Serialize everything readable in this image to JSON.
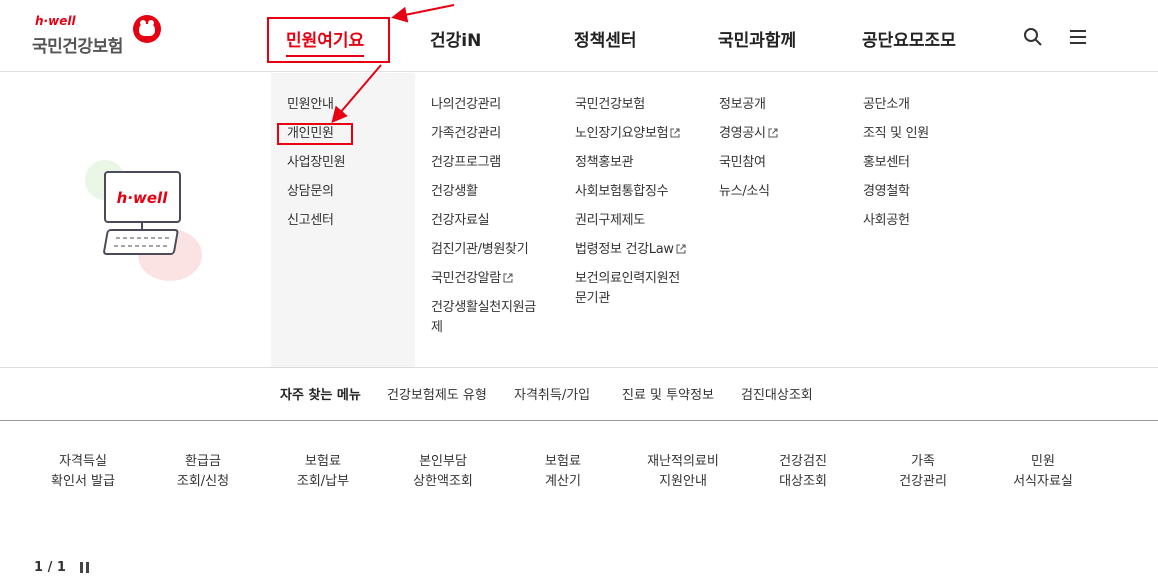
{
  "logo": {
    "brand": "h·well",
    "org_name": "국민건강보험"
  },
  "gnb": {
    "items": [
      "민원여기요",
      "건강iN",
      "정책센터",
      "국민과함께",
      "공단요모조모"
    ],
    "active_index": 0,
    "icons": [
      "search-icon",
      "menu-icon"
    ]
  },
  "mega_menu": {
    "col1": [
      "민원안내",
      "개인민원",
      "사업장민원",
      "상담문의",
      "신고센터"
    ],
    "col2": [
      "나의건강관리",
      "가족건강관리",
      "건강프로그램",
      "건강생활",
      "건강자료실",
      "검진기관/병원찾기",
      "국민건강알람",
      "건강생활실천지원금제"
    ],
    "col3": [
      "국민건강보험",
      "노인장기요양보험",
      "정책홍보관",
      "사회보험통합징수",
      "권리구제제도",
      "법령정보 건강Law",
      "보건의료인력지원전문기관"
    ],
    "col4": [
      "정보공개",
      "경영공시",
      "국민참여",
      "뉴스/소식"
    ],
    "col5": [
      "공단소개",
      "조직 및 인원",
      "홍보센터",
      "경영철학",
      "사회공헌"
    ],
    "illustration_text": "h·well"
  },
  "frequent": {
    "title": "자주 찾는 메뉴",
    "links": [
      "건강보험제도 유형",
      "자격취득/가입",
      "진료 및 투약정보",
      "검진대상조회"
    ]
  },
  "quick_menu": [
    [
      "자격득실",
      "확인서 발급"
    ],
    [
      "환급금",
      "조회/신청"
    ],
    [
      "보험료",
      "조회/납부"
    ],
    [
      "본인부담",
      "상한액조회"
    ],
    [
      "보험료",
      "계산기"
    ],
    [
      "재난적의료비",
      "지원안내"
    ],
    [
      "건강검진",
      "대상조회"
    ],
    [
      "가족",
      "건강관리"
    ],
    [
      "민원",
      "서식자료실"
    ]
  ],
  "pager": {
    "text": "1 / 1"
  },
  "colors": {
    "accent": "#e60012",
    "text": "#333333",
    "menu_bg": "#f5f5f5"
  }
}
